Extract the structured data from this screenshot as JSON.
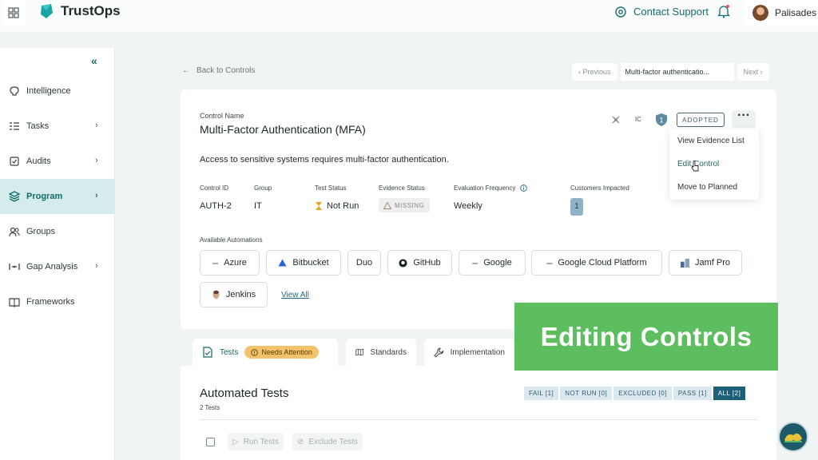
{
  "app": {
    "name": "TrustOps"
  },
  "header": {
    "support_label": "Contact Support",
    "user_name": "Palisades"
  },
  "sidebar": {
    "items": [
      {
        "label": "Intelligence",
        "icon": "brain-icon",
        "chevron": false,
        "active": false
      },
      {
        "label": "Tasks",
        "icon": "tasks-icon",
        "chevron": true,
        "active": false
      },
      {
        "label": "Audits",
        "icon": "audit-icon",
        "chevron": true,
        "active": false
      },
      {
        "label": "Program",
        "icon": "layers-icon",
        "chevron": true,
        "active": true
      },
      {
        "label": "Groups",
        "icon": "users-icon",
        "chevron": false,
        "active": false
      },
      {
        "label": "Gap Analysis",
        "icon": "gap-icon",
        "chevron": true,
        "active": false
      },
      {
        "label": "Frameworks",
        "icon": "book-icon",
        "chevron": false,
        "active": false
      }
    ]
  },
  "nav": {
    "back_label": "Back to Controls",
    "previous_label": "Previous",
    "current_label": "Multi-factor authenticatio...",
    "next_label": "Next"
  },
  "control": {
    "name_label": "Control Name",
    "name": "Multi-Factor Authentication (MFA)",
    "description": "Access to sensitive systems requires multi-factor authentication.",
    "ic_label": "IC",
    "shield_count": "1",
    "status_badge": "ADOPTED",
    "meta": {
      "id_label": "Control ID",
      "id_value": "AUTH-2",
      "group_label": "Group",
      "group_value": "IT",
      "test_status_label": "Test Status",
      "test_status_value": "Not Run",
      "evidence_label": "Evidence Status",
      "evidence_value": "MISSING",
      "frequency_label": "Evaluation Frequency",
      "frequency_value": "Weekly",
      "customers_label": "Customers Impacted",
      "customers_value": "1"
    },
    "automations_label": "Available Automations",
    "automations": [
      "Azure",
      "Bitbucket",
      "Duo",
      "GitHub",
      "Google",
      "Google Cloud Platform",
      "Jamf Pro",
      "Jenkins"
    ],
    "view_all": "View All"
  },
  "menu": {
    "items": [
      "View Evidence List",
      "Edit Control",
      "Move to Planned"
    ]
  },
  "tabs": {
    "tests": "Tests",
    "needs_attention": "Needs Attention",
    "standards": "Standards",
    "implementation": "Implementation"
  },
  "tests": {
    "title": "Automated Tests",
    "subtitle": "2 Tests",
    "filters": [
      "FAIL [1]",
      "NOT RUN [0]",
      "EXCLUDED [0]",
      "PASS [1]",
      "ALL [2]"
    ],
    "run_label": "Run Tests",
    "exclude_label": "Exclude Tests"
  },
  "overlay": {
    "caption": "Editing Controls"
  },
  "colors": {
    "brand": "#156868",
    "active_nav_bg": "#d5ecec",
    "banner": "#5cbe5f",
    "attention": "#f2c36b",
    "filter_selected": "#1d5f78"
  }
}
